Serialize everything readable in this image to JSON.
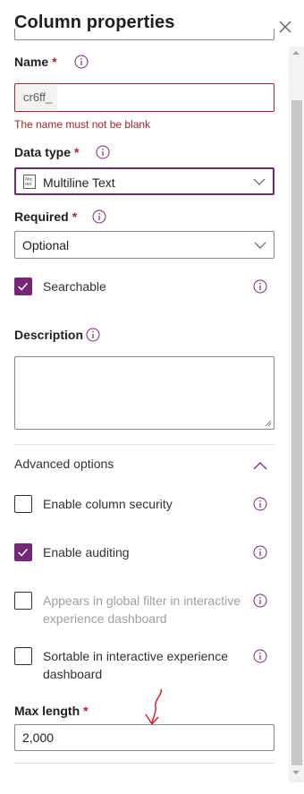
{
  "panel": {
    "title": "Column properties"
  },
  "name_field": {
    "label": "Name",
    "required_mark": "*",
    "prefix": "cr6ff_",
    "value": "",
    "error": "The name must not be blank"
  },
  "data_type": {
    "label": "Data type",
    "required_mark": "*",
    "selected": "Multiline Text",
    "icon": "multiline-text-icon"
  },
  "required": {
    "label": "Required",
    "required_mark": "*",
    "selected": "Optional"
  },
  "searchable": {
    "label": "Searchable",
    "checked": true
  },
  "description": {
    "label": "Description",
    "value": ""
  },
  "advanced": {
    "label": "Advanced options",
    "expanded": true,
    "options": [
      {
        "label": "Enable column security",
        "checked": false,
        "disabled": false
      },
      {
        "label": "Enable auditing",
        "checked": true,
        "disabled": false
      },
      {
        "label": "Appears in global filter in interactive experience dashboard",
        "checked": false,
        "disabled": true
      },
      {
        "label": "Sortable in interactive experience dashboard",
        "checked": false,
        "disabled": false
      }
    ]
  },
  "max_length": {
    "label": "Max length",
    "required_mark": "*",
    "value": "2,000"
  },
  "colors": {
    "accent": "#742774",
    "error": "#a4262c",
    "annotation": "#e81123"
  }
}
